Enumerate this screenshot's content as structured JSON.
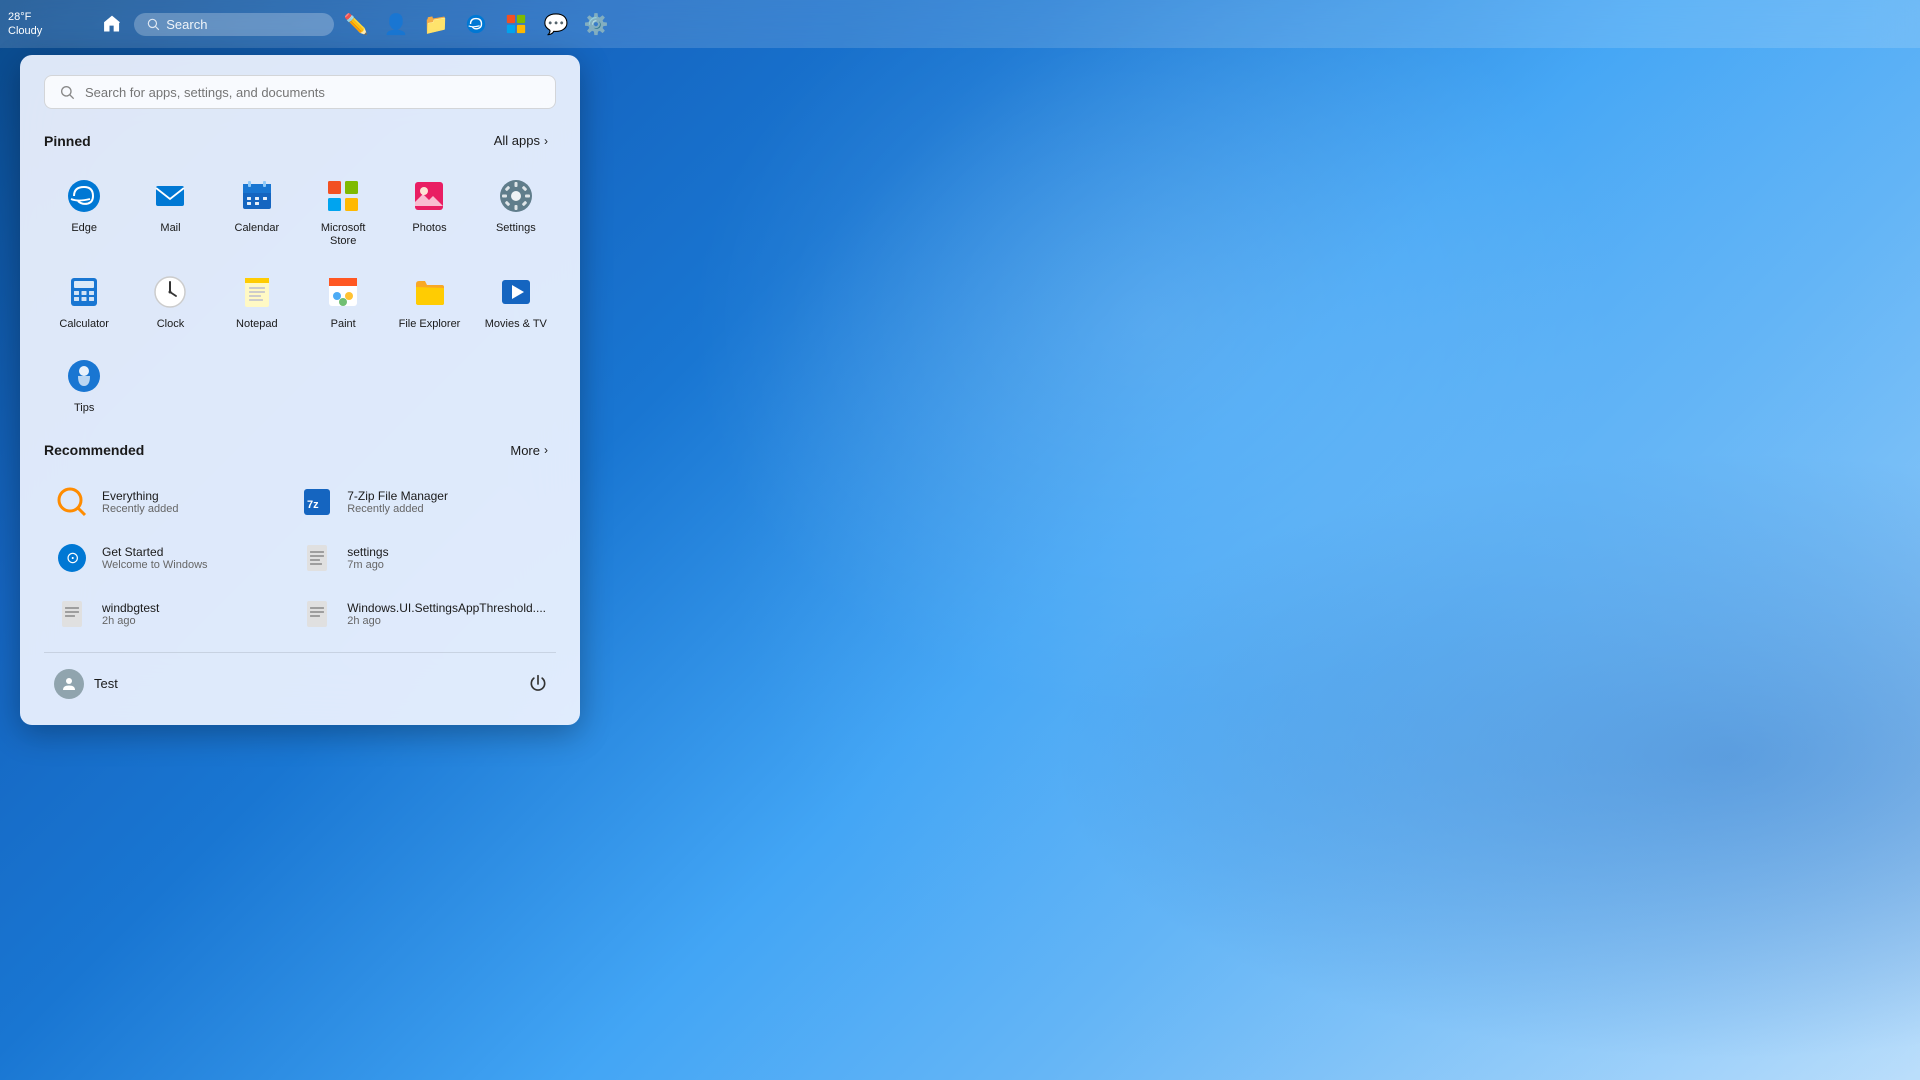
{
  "weather": {
    "temperature": "28°F",
    "condition": "Cloudy"
  },
  "taskbar": {
    "search_placeholder": "Search",
    "icons": [
      "start",
      "search",
      "sketch",
      "avatar",
      "files",
      "edge-taskbar",
      "msstore",
      "teams",
      "settings"
    ]
  },
  "start_menu": {
    "search_placeholder": "Search for apps, settings, and documents",
    "pinned": {
      "title": "Pinned",
      "all_apps_label": "All apps",
      "apps": [
        {
          "id": "edge",
          "label": "Edge",
          "icon": "edge"
        },
        {
          "id": "mail",
          "label": "Mail",
          "icon": "mail"
        },
        {
          "id": "calendar",
          "label": "Calendar",
          "icon": "calendar"
        },
        {
          "id": "microsoft-store",
          "label": "Microsoft Store",
          "icon": "store"
        },
        {
          "id": "photos",
          "label": "Photos",
          "icon": "photos"
        },
        {
          "id": "settings",
          "label": "Settings",
          "icon": "settings"
        },
        {
          "id": "calculator",
          "label": "Calculator",
          "icon": "calculator"
        },
        {
          "id": "clock",
          "label": "Clock",
          "icon": "clock"
        },
        {
          "id": "notepad",
          "label": "Notepad",
          "icon": "notepad"
        },
        {
          "id": "paint",
          "label": "Paint",
          "icon": "paint"
        },
        {
          "id": "file-explorer",
          "label": "File Explorer",
          "icon": "explorer"
        },
        {
          "id": "movies-tv",
          "label": "Movies & TV",
          "icon": "movies"
        },
        {
          "id": "tips",
          "label": "Tips",
          "icon": "tips"
        }
      ]
    },
    "recommended": {
      "title": "Recommended",
      "more_label": "More",
      "items": [
        {
          "id": "everything",
          "name": "Everything",
          "subtitle": "Recently added",
          "icon": "search-orange"
        },
        {
          "id": "7zip",
          "name": "7-Zip File Manager",
          "subtitle": "Recently added",
          "icon": "7zip"
        },
        {
          "id": "get-started",
          "name": "Get Started",
          "subtitle": "Welcome to Windows",
          "icon": "get-started"
        },
        {
          "id": "settings-rec",
          "name": "settings",
          "subtitle": "7m ago",
          "icon": "settings-file"
        },
        {
          "id": "windbgtest",
          "name": "windbgtest",
          "subtitle": "2h ago",
          "icon": "file"
        },
        {
          "id": "windows-ui",
          "name": "Windows.UI.SettingsAppThreshold....",
          "subtitle": "2h ago",
          "icon": "file"
        }
      ]
    },
    "footer": {
      "user_name": "Test",
      "power_label": "Power"
    }
  }
}
